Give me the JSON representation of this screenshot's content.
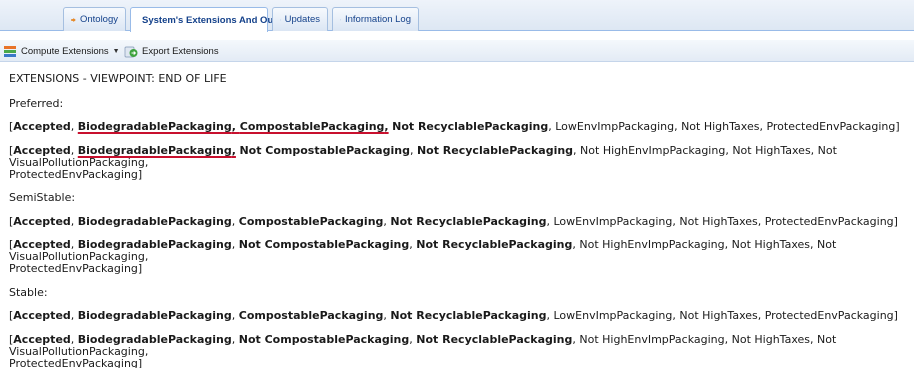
{
  "tabs": [
    {
      "label": "Ontology",
      "icon": "arrow-right-icon",
      "active": false
    },
    {
      "label": "System's Extensions And Output",
      "icon": "star-trophy-icon",
      "active": true
    },
    {
      "label": "Updates",
      "icon": "refresh-icon",
      "active": false
    },
    {
      "label": "Information Log",
      "icon": "window-log-icon",
      "active": false
    }
  ],
  "toolbar": {
    "compute_label": "Compute Extensions",
    "export_label": "Export Extensions"
  },
  "content": {
    "heading": "EXTENSIONS - VIEWPOINT: END OF LIFE",
    "sections": [
      {
        "title": "Preferred:",
        "extensions": [
          {
            "bold": [
              "Accepted",
              "BiodegradablePackaging",
              "CompostablePackaging",
              "Not RecyclablePackaging"
            ],
            "normal": [
              "LowEnvImpPackaging",
              "Not HighTaxes",
              "ProtectedEnvPackaging"
            ]
          },
          {
            "bold": [
              "Accepted",
              "BiodegradablePackaging",
              "Not CompostablePackaging",
              "Not RecyclablePackaging"
            ],
            "normal": [
              "Not HighEnvImpPackaging",
              "Not HighTaxes",
              "Not VisualPollutionPackaging",
              "ProtectedEnvPackaging"
            ]
          }
        ]
      },
      {
        "title": "SemiStable:",
        "extensions": [
          {
            "bold": [
              "Accepted",
              "BiodegradablePackaging",
              "CompostablePackaging",
              "Not RecyclablePackaging"
            ],
            "normal": [
              "LowEnvImpPackaging",
              "Not HighTaxes",
              "ProtectedEnvPackaging"
            ]
          },
          {
            "bold": [
              "Accepted",
              "BiodegradablePackaging",
              "Not CompostablePackaging",
              "Not RecyclablePackaging"
            ],
            "normal": [
              "Not HighEnvImpPackaging",
              "Not HighTaxes",
              "Not VisualPollutionPackaging",
              "ProtectedEnvPackaging"
            ]
          }
        ]
      },
      {
        "title": "Stable:",
        "extensions": [
          {
            "bold": [
              "Accepted",
              "BiodegradablePackaging",
              "CompostablePackaging",
              "Not RecyclablePackaging"
            ],
            "normal": [
              "LowEnvImpPackaging",
              "Not HighTaxes",
              "ProtectedEnvPackaging"
            ]
          },
          {
            "bold": [
              "Accepted",
              "BiodegradablePackaging",
              "Not CompostablePackaging",
              "Not RecyclablePackaging"
            ],
            "normal": [
              "Not HighEnvImpPackaging",
              "Not HighTaxes",
              "Not VisualPollutionPackaging",
              "ProtectedEnvPackaging"
            ]
          }
        ]
      }
    ]
  },
  "colors": {
    "tab_text": "#15428b",
    "underline_annotation": "#c8102e"
  }
}
